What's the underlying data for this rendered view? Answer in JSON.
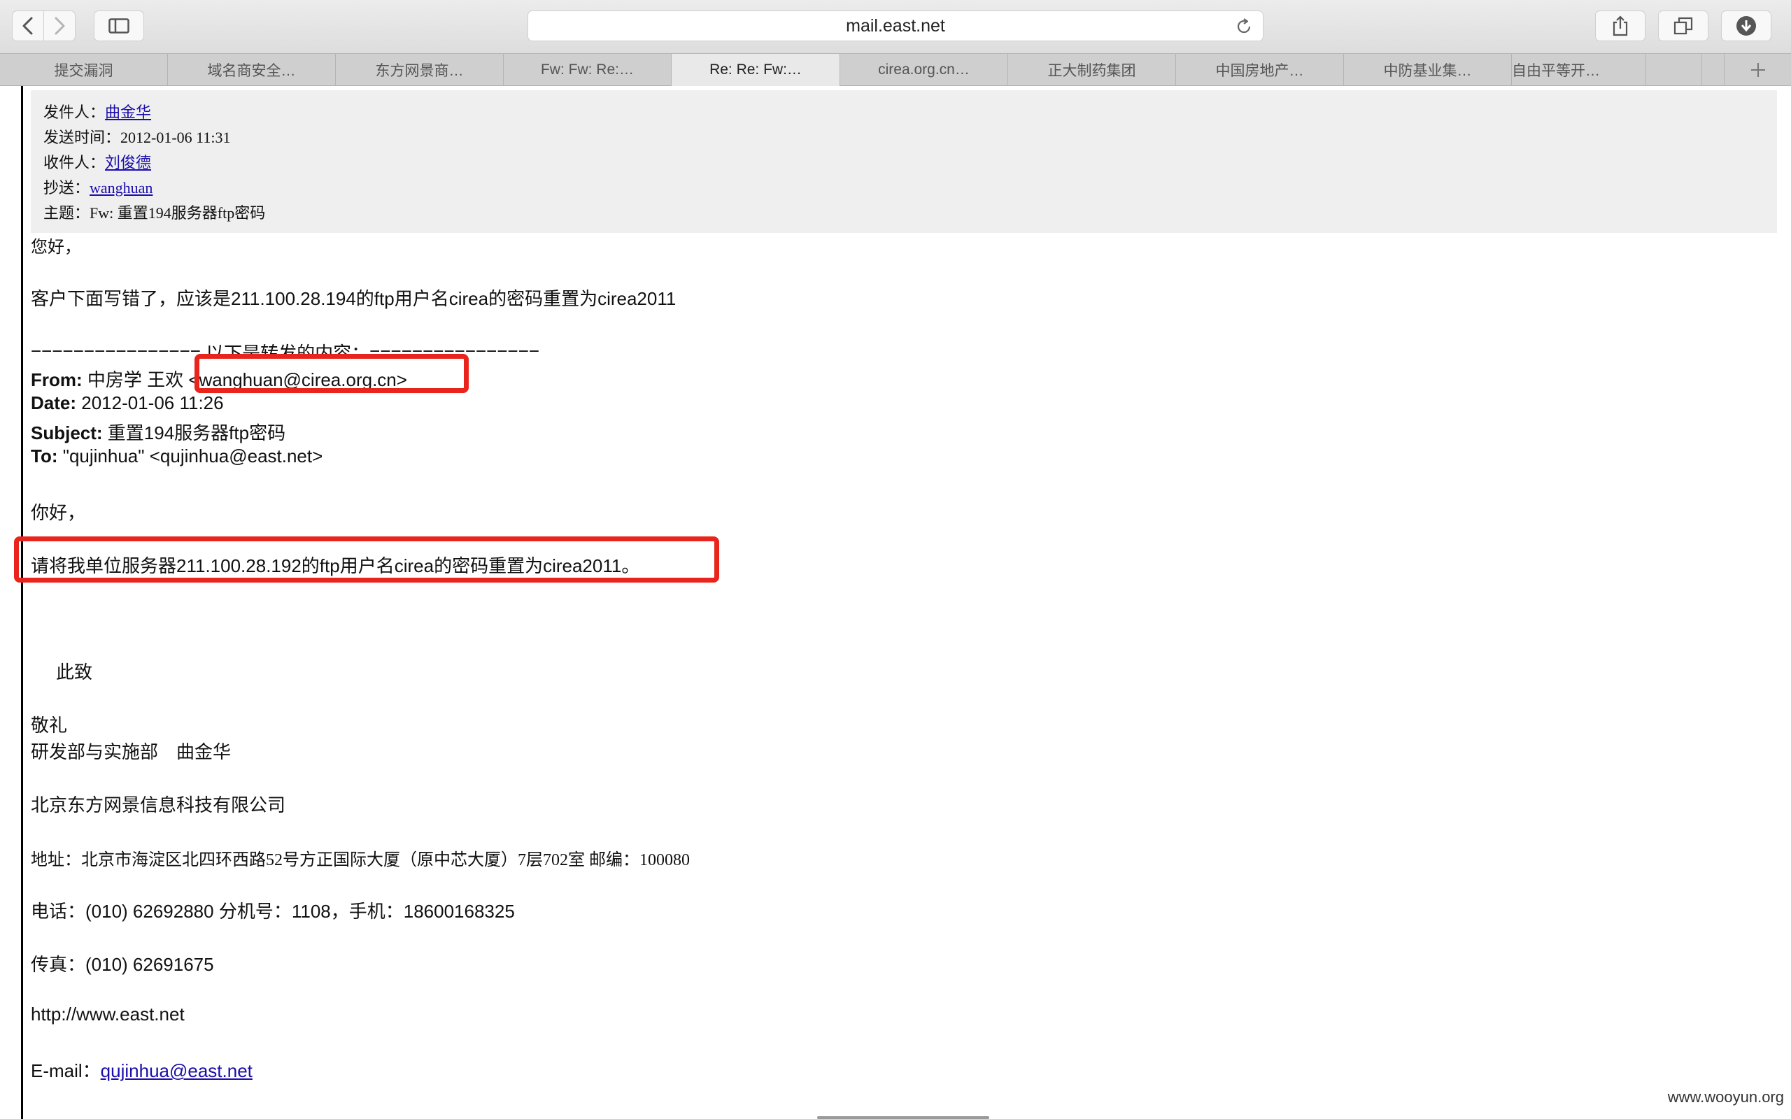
{
  "browser": {
    "url": "mail.east.net",
    "tabs": [
      {
        "label": "提交漏洞"
      },
      {
        "label": "域名商安全…"
      },
      {
        "label": "东方网景商…"
      },
      {
        "label": "Fw: Fw: Re:…"
      },
      {
        "label": "Re: Re: Fw:…",
        "active": true
      },
      {
        "label": "cirea.org.cn…"
      },
      {
        "label": "正大制药集团"
      },
      {
        "label": "中国房地产…"
      },
      {
        "label": "中防基业集…"
      },
      {
        "label": "自由平等开…"
      },
      {
        "label": ""
      }
    ]
  },
  "header": {
    "from_label": "发件人：",
    "from_value": "曲金华",
    "sent_label": "发送时间：",
    "sent_value": "2012-01-06 11:31",
    "to_label": "收件人：",
    "to_value": "刘俊德",
    "cc_label": "抄送：",
    "cc_value": "wanghuan",
    "subject_label": "主题：",
    "subject_value": "Fw: 重置194服务器ftp密码"
  },
  "body": {
    "greeting": "您好，",
    "note": "客户下面写错了，应该是211.100.28.194的ftp用户名cirea的密码重置为cirea2011",
    "divider": "================ 以下是转发的内容：================",
    "fwd_from_label": "From:",
    "fwd_from_value": " 中房学 王欢 <wanghuan@cirea.org.cn>",
    "fwd_date_label": "Date:",
    "fwd_date_value": " 2012-01-06 11:26",
    "fwd_subject_label": "Subject:",
    "fwd_subject_value": " 重置194服务器ftp密码",
    "fwd_to_label": "To:",
    "fwd_to_value": " \"qujinhua\" <qujinhua@east.net>",
    "fwd_greeting": "你好，",
    "fwd_request": "请将我单位服务器211.100.28.192的ftp用户名cirea的密码重置为cirea2011。",
    "closing": "此致",
    "regards": "敬礼",
    "signer": "研发部与实施部　曲金华",
    "company": "北京东方网景信息科技有限公司",
    "address": "地址：北京市海淀区北四环西路52号方正国际大厦（原中芯大厦）7层702室 邮编：100080",
    "phone": "电话：(010) 62692880 分机号：1108，手机：18600168325",
    "fax": "传真：(010) 62691675",
    "website": "http://www.east.net",
    "email_label": "E-mail：",
    "email_value": "qujinhua@east.net"
  },
  "watermark": "www.wooyun.org",
  "colors": {
    "highlight": "#e8241c",
    "link": "#1a0dab",
    "header_bg": "#efefef"
  },
  "icons": [
    "back-icon",
    "forward-icon",
    "sidebar-icon",
    "reload-icon",
    "share-icon",
    "tabs-icon",
    "download-icon",
    "new-tab-icon"
  ]
}
